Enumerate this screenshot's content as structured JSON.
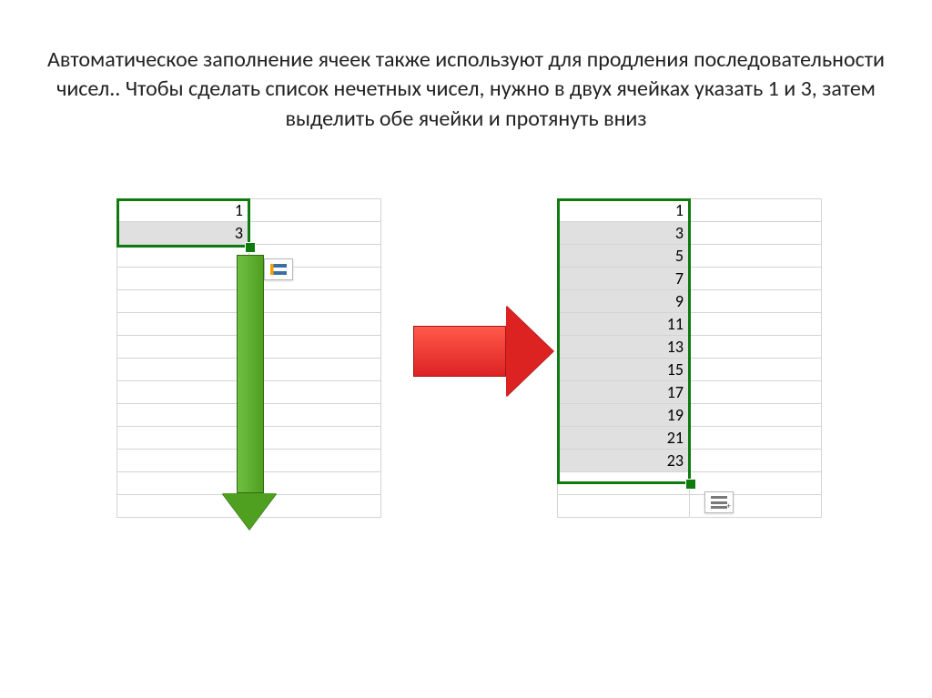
{
  "title_text": "Автоматическое заполнение ячеек также используют для продления последовательности чисел.. Чтобы сделать список нечетных чисел, нужно в двух ячейках указать 1 и 3, затем выделить обе ячейки и протянуть вниз",
  "left_sheet": {
    "selection": [
      "1",
      "3"
    ]
  },
  "right_sheet": {
    "selection": [
      "1",
      "3",
      "5",
      "7",
      "9",
      "11",
      "13",
      "15",
      "17",
      "19",
      "21",
      "23"
    ]
  },
  "icons": {
    "autofill_options": "autofill-options",
    "autofill_series": "autofill-series"
  }
}
